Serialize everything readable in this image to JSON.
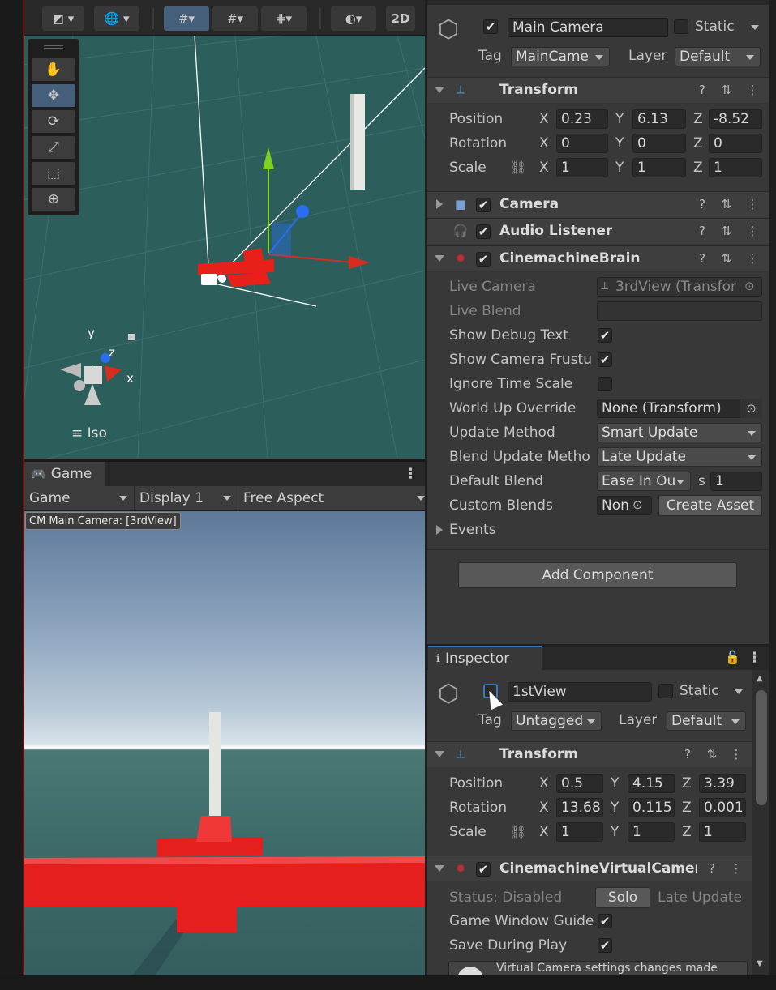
{
  "scene": {
    "toolbar": {
      "btn_2d": "2D"
    },
    "iso_label": "Iso",
    "gizmo_axes": {
      "x": "x",
      "y": "y",
      "z": "z"
    }
  },
  "game": {
    "tab_label": "Game",
    "mode_dropdown": "Game",
    "display_dropdown": "Display 1",
    "aspect_dropdown": "Free Aspect",
    "cm_overlay": "CM Main Camera: [3rdView]"
  },
  "inspector_top": {
    "object_name": "Main Camera",
    "static_label": "Static",
    "tag_label": "Tag",
    "tag_value": "MainCame",
    "layer_label": "Layer",
    "layer_value": "Default",
    "transform": {
      "title": "Transform",
      "position_label": "Position",
      "rotation_label": "Rotation",
      "scale_label": "Scale",
      "position": {
        "x": "0.23",
        "y": "6.13",
        "z": "-8.52"
      },
      "rotation": {
        "x": "0",
        "y": "0",
        "z": "0"
      },
      "scale": {
        "x": "1",
        "y": "1",
        "z": "1"
      }
    },
    "components": {
      "camera": "Camera",
      "audio_listener": "Audio Listener",
      "cinemachine_brain": "CinemachineBrain"
    },
    "brain": {
      "live_camera_label": "Live Camera",
      "live_camera_value": "3rdView (Transfor",
      "live_blend_label": "Live Blend",
      "show_debug_label": "Show Debug Text",
      "show_frustum_label": "Show Camera Frustu",
      "ignore_time_label": "Ignore Time Scale",
      "world_up_label": "World Up Override",
      "world_up_value": "None (Transform)",
      "update_method_label": "Update Method",
      "update_method_value": "Smart Update",
      "blend_update_label": "Blend Update Metho",
      "blend_update_value": "Late Update",
      "default_blend_label": "Default Blend",
      "default_blend_value": "Ease In Ou",
      "default_blend_s": "s",
      "default_blend_time": "1",
      "custom_blends_label": "Custom Blends",
      "custom_blends_value": "Non",
      "create_asset": "Create Asset",
      "events_label": "Events"
    },
    "add_component": "Add Component"
  },
  "inspector_bottom": {
    "tab_label": "Inspector",
    "object_name": "1stView",
    "static_label": "Static",
    "tag_label": "Tag",
    "tag_value": "Untagged",
    "layer_label": "Layer",
    "layer_value": "Default",
    "transform": {
      "title": "Transform",
      "position_label": "Position",
      "rotation_label": "Rotation",
      "scale_label": "Scale",
      "position": {
        "x": "0.5",
        "y": "4.15",
        "z": "3.39"
      },
      "rotation": {
        "x": "13.68",
        "y": "0.115",
        "z": "0.001"
      },
      "scale": {
        "x": "1",
        "y": "1",
        "z": "1"
      }
    },
    "vcam_title": "CinemachineVirtualCamera",
    "status_label": "Status: Disabled",
    "solo_button": "Solo",
    "late_update": "Late Update",
    "game_window_guides": "Game Window Guide",
    "save_during_play": "Save During Play",
    "info_text": "Virtual Camera settings changes made"
  },
  "axis_labels": {
    "x": "X",
    "y": "Y",
    "z": "Z"
  },
  "colors": {
    "accent_blue": "#46607c",
    "scene_bg": "#2c5e5c",
    "plane_red": "#e8201a"
  }
}
